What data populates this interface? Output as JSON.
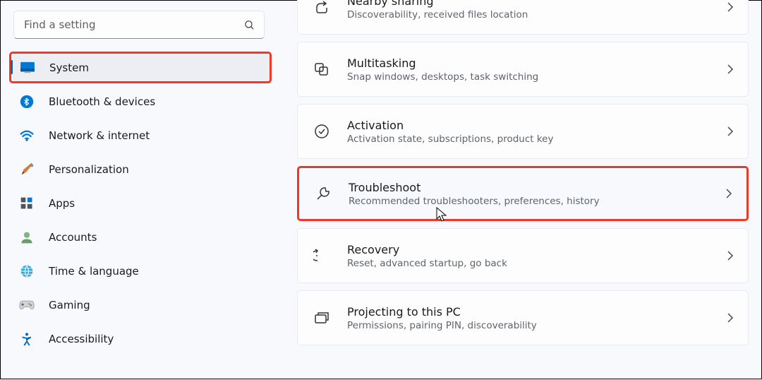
{
  "search": {
    "placeholder": "Find a setting"
  },
  "sidebar": {
    "items": [
      {
        "label": "System"
      },
      {
        "label": "Bluetooth & devices"
      },
      {
        "label": "Network & internet"
      },
      {
        "label": "Personalization"
      },
      {
        "label": "Apps"
      },
      {
        "label": "Accounts"
      },
      {
        "label": "Time & language"
      },
      {
        "label": "Gaming"
      },
      {
        "label": "Accessibility"
      }
    ]
  },
  "cards": [
    {
      "title": "Nearby sharing",
      "desc": "Discoverability, received files location"
    },
    {
      "title": "Multitasking",
      "desc": "Snap windows, desktops, task switching"
    },
    {
      "title": "Activation",
      "desc": "Activation state, subscriptions, product key"
    },
    {
      "title": "Troubleshoot",
      "desc": "Recommended troubleshooters, preferences, history"
    },
    {
      "title": "Recovery",
      "desc": "Reset, advanced startup, go back"
    },
    {
      "title": "Projecting to this PC",
      "desc": "Permissions, pairing PIN, discoverability"
    }
  ]
}
